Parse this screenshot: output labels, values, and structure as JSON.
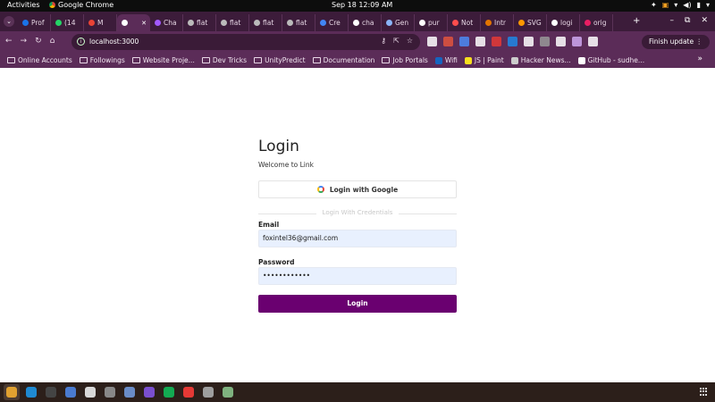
{
  "topbar": {
    "activities": "Activities",
    "app_name": "Google Chrome",
    "clock": "Sep 18  12:09 AM"
  },
  "tabs": [
    {
      "label": "Prof",
      "color": "#1a73e8"
    },
    {
      "label": "(14",
      "color": "#25d366"
    },
    {
      "label": "M",
      "color": "#ea4335"
    },
    {
      "label": "",
      "color": "#ffffff",
      "active": true
    },
    {
      "label": "Cha",
      "color": "#a259ff"
    },
    {
      "label": "flat",
      "color": "#bbbbbb"
    },
    {
      "label": "flat",
      "color": "#bbbbbb"
    },
    {
      "label": "flat",
      "color": "#bbbbbb"
    },
    {
      "label": "flat",
      "color": "#bbbbbb"
    },
    {
      "label": "Cre",
      "color": "#4285f4"
    },
    {
      "label": "cha",
      "color": "#ffffff"
    },
    {
      "label": "Gen",
      "color": "#8ab4f8"
    },
    {
      "label": "pur",
      "color": "#ffffff"
    },
    {
      "label": "Not",
      "color": "#ff4d4d"
    },
    {
      "label": "Intr",
      "color": "#e37400"
    },
    {
      "label": "SVG",
      "color": "#ff9800"
    },
    {
      "label": "logi",
      "color": "#ffffff"
    },
    {
      "label": "orig",
      "color": "#e91e63"
    }
  ],
  "toolbar": {
    "url": "localhost:3000",
    "update_button": "Finish update"
  },
  "bookmarks": [
    {
      "label": "Online Accounts",
      "type": "folder"
    },
    {
      "label": "Followings",
      "type": "folder"
    },
    {
      "label": "Website Proje...",
      "type": "folder"
    },
    {
      "label": "Dev Tricks",
      "type": "folder"
    },
    {
      "label": "UnityPredict",
      "type": "folder"
    },
    {
      "label": "Documentation",
      "type": "folder"
    },
    {
      "label": "Job Portals",
      "type": "folder"
    },
    {
      "label": "Wifi",
      "type": "link",
      "color": "#1565c0"
    },
    {
      "label": "JS | Paint",
      "type": "link",
      "color": "#f7df1e"
    },
    {
      "label": "Hacker News...",
      "type": "link",
      "color": "#cccccc"
    },
    {
      "label": "GitHub - sudhe...",
      "type": "link",
      "color": "#ffffff"
    }
  ],
  "login": {
    "title": "Login",
    "subtitle": "Welcome to Link",
    "google_button": "Login with Google",
    "divider_text": "Login With Credentials",
    "email_label": "Email",
    "email_value": "foxintel36@gmail.com",
    "password_label": "Password",
    "password_value": "••••••••••••",
    "submit_label": "Login",
    "accent_color": "#6a0070"
  },
  "dock": {
    "apps": [
      {
        "name": "chrome",
        "color": "#e0a030",
        "active": true
      },
      {
        "name": "vscode",
        "color": "#1f8ad2"
      },
      {
        "name": "terminal",
        "color": "#444444"
      },
      {
        "name": "docs",
        "color": "#4a7bd0"
      },
      {
        "name": "text-editor",
        "color": "#d8d8d8"
      },
      {
        "name": "inkscape",
        "color": "#888888"
      },
      {
        "name": "files",
        "color": "#6a8cc7"
      },
      {
        "name": "github",
        "color": "#7a4fcf"
      },
      {
        "name": "mongodb",
        "color": "#13aa52"
      },
      {
        "name": "alert",
        "color": "#e53935"
      },
      {
        "name": "disk",
        "color": "#9e9e9e"
      },
      {
        "name": "trash",
        "color": "#7fb27f"
      }
    ]
  }
}
